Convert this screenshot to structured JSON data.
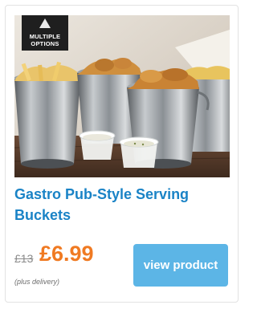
{
  "product": {
    "badge": {
      "line1": "MULTIPLE",
      "line2": "OPTIONS"
    },
    "image_icon": "product-photo-serving-buckets",
    "title": "Gastro Pub-Style Serving Buckets",
    "old_price": "£13",
    "price": "£6.99",
    "delivery_note": "(plus delivery)",
    "view_button_label": "view product"
  },
  "colors": {
    "title": "#1a83c6",
    "price": "#f07a22",
    "button": "#5cb5e6",
    "badge": "#1f1f1f"
  }
}
